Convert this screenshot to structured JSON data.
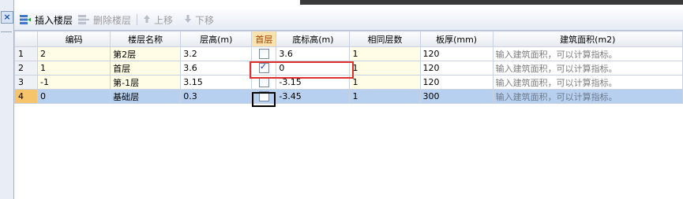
{
  "toolbar": {
    "insert_label": "插入楼层",
    "delete_label": "删除楼层",
    "up_label": "上移",
    "down_label": "下移"
  },
  "left": {
    "close_label": "×"
  },
  "columns": [
    "编码",
    "楼层名称",
    "层高(m)",
    "首层",
    "底标高(m)",
    "相同层数",
    "板厚(mm)",
    "建筑面积(m2)"
  ],
  "rows": [
    {
      "num": "1",
      "code": "2",
      "name": "第2层",
      "height": "3.2",
      "first": false,
      "base": "3.6",
      "same": "1",
      "thick": "120",
      "area": "输入建筑面积，可以计算指标。"
    },
    {
      "num": "2",
      "code": "1",
      "name": "首层",
      "height": "3.6",
      "first": true,
      "base": "0",
      "same": "1",
      "thick": "120",
      "area": "输入建筑面积，可以计算指标。"
    },
    {
      "num": "3",
      "code": "-1",
      "name": "第-1层",
      "height": "3.15",
      "first": false,
      "base": "-3.15",
      "same": "1",
      "thick": "120",
      "area": "输入建筑面积，可以计算指标。"
    },
    {
      "num": "4",
      "code": "0",
      "name": "基础层",
      "height": "0.3",
      "first": false,
      "base": "-3.45",
      "same": "1",
      "thick": "300",
      "area": "输入建筑面积，可以计算指标。"
    }
  ],
  "colors": {
    "selected_row": "#b8d0ef",
    "annotation": "#e0302e",
    "header_highlight": "#fbe3b0"
  }
}
